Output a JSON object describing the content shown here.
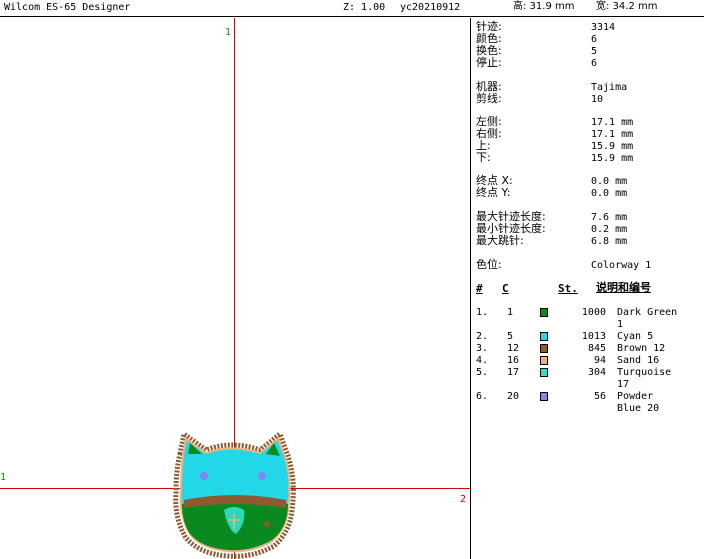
{
  "title_bar": {
    "app_title": "Wilcom ES-65 Designer",
    "zoom": "Z: 1.00",
    "file_name": "yc20210912",
    "height_label": "高: 31.9 mm",
    "width_label": "宽: 34.2 mm"
  },
  "canvas": {
    "top_marker": "1",
    "left_marker": "1",
    "right_marker": "2"
  },
  "info": {
    "stitches_label": "针迹:",
    "stitches": "3314",
    "colors_label": "颜色:",
    "colors": "6",
    "changes_label": "换色:",
    "changes": "5",
    "stops_label": "停止:",
    "stops": "6",
    "machine_label": "机器:",
    "machine": "Tajima",
    "trims_label": "剪线:",
    "trims": "10",
    "left_label": "左侧:",
    "left": "17.1 mm",
    "right_label": "右侧:",
    "right": "17.1 mm",
    "up_label": "上:",
    "up": "15.9 mm",
    "down_label": "下:",
    "down": "15.9 mm",
    "end_x_label": "终点 X:",
    "end_x": "0.0 mm",
    "end_y_label": "终点 Y:",
    "end_y": "0.0 mm",
    "max_stitch_label": "最大针迹长度:",
    "max_stitch": "7.6 mm",
    "min_stitch_label": "最小针迹长度:",
    "min_stitch": "0.2 mm",
    "max_jump_label": "最大跳针:",
    "max_jump": "6.8 mm",
    "colorway_label": "色位:",
    "colorway": "Colorway 1"
  },
  "table": {
    "headers": {
      "num": "#",
      "code": "C",
      "stitches": "St.",
      "desc": "说明和编号"
    },
    "rows": [
      {
        "num": "1.",
        "code": "1",
        "color": "#0a8a1e",
        "stitches": "1000",
        "desc1": "Dark Green",
        "desc2": "1"
      },
      {
        "num": "2.",
        "code": "5",
        "color": "#22d8e8",
        "stitches": "1013",
        "desc1": "Cyan 5",
        "desc2": ""
      },
      {
        "num": "3.",
        "code": "12",
        "color": "#8e5a32",
        "stitches": "845",
        "desc1": "Brown 12",
        "desc2": ""
      },
      {
        "num": "4.",
        "code": "16",
        "color": "#f0b27a",
        "stitches": "94",
        "desc1": "Sand 16",
        "desc2": ""
      },
      {
        "num": "5.",
        "code": "17",
        "color": "#2fe0c8",
        "stitches": "304",
        "desc1": "Turquoise",
        "desc2": "17"
      },
      {
        "num": "6.",
        "code": "20",
        "color": "#7f86f2",
        "stitches": "56",
        "desc1": "Powder",
        "desc2": "Blue 20"
      }
    ]
  }
}
